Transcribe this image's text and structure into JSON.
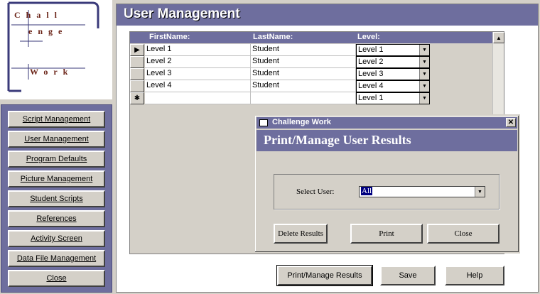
{
  "logo": {
    "line1": "Chall",
    "line2": "enge",
    "line3": "Work"
  },
  "menu": {
    "items": [
      {
        "label": "Script Management"
      },
      {
        "label": "User Management"
      },
      {
        "label": "Program Defaults"
      },
      {
        "label": "Picture Management"
      },
      {
        "label": "Student Scripts"
      },
      {
        "label": "References"
      },
      {
        "label": "Activity Screen"
      },
      {
        "label": "Data File Management"
      },
      {
        "label": "Close"
      }
    ]
  },
  "main": {
    "title": "User Management",
    "columns": {
      "first": "FirstName:",
      "last": "LastName:",
      "level": "Level:"
    },
    "rows": [
      {
        "first": "Level 1",
        "last": "Student",
        "level": "Level 1",
        "selector": "▶"
      },
      {
        "first": "Level 2",
        "last": "Student",
        "level": "Level 2",
        "selector": ""
      },
      {
        "first": "Level 3",
        "last": "Student",
        "level": "Level 3",
        "selector": ""
      },
      {
        "first": "Level 4",
        "last": "Student",
        "level": "Level 4",
        "selector": ""
      },
      {
        "first": "",
        "last": "",
        "level": "Level 1",
        "selector": "✱"
      }
    ],
    "buttons": {
      "print_manage": "Print/Manage Results",
      "save": "Save",
      "help": "Help"
    }
  },
  "dialog": {
    "window_title": "Challenge Work",
    "header": "Print/Manage User Results",
    "select_label": "Select User:",
    "select_value": "All",
    "buttons": {
      "delete": "Delete Results",
      "print": "Print",
      "close": "Close"
    }
  }
}
